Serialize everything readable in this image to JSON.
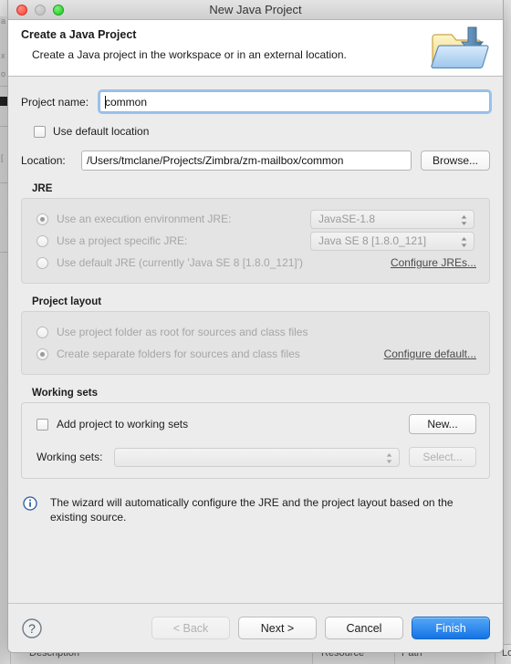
{
  "window": {
    "title": "New Java Project",
    "traffic_lights": [
      "close-red",
      "minimize-disabled",
      "zoom-green"
    ]
  },
  "header": {
    "title": "Create a Java Project",
    "subtitle": "Create a Java project in the workspace or in an external location.",
    "icon": "import-project-folder-icon"
  },
  "form": {
    "project_name_label": "Project name:",
    "project_name_value": "common",
    "use_default_location_label": "Use default location",
    "use_default_location_checked": false,
    "location_label": "Location:",
    "location_value": "/Users/tmclane/Projects/Zimbra/zm-mailbox/common",
    "browse_label": "Browse..."
  },
  "jre": {
    "group_title": "JRE",
    "options": [
      {
        "label": "Use an execution environment JRE:",
        "selected": true,
        "combo": "JavaSE-1.8"
      },
      {
        "label": "Use a project specific JRE:",
        "selected": false,
        "combo": "Java SE 8 [1.8.0_121]"
      },
      {
        "label": "Use default JRE (currently 'Java SE 8 [1.8.0_121]')",
        "selected": false,
        "combo": null
      }
    ],
    "configure_link": "Configure JREs..."
  },
  "layout": {
    "group_title": "Project layout",
    "options": [
      {
        "label": "Use project folder as root for sources and class files",
        "selected": false
      },
      {
        "label": "Create separate folders for sources and class files",
        "selected": true
      }
    ],
    "configure_link": "Configure default..."
  },
  "working_sets": {
    "group_title": "Working sets",
    "add_label": "Add project to working sets",
    "add_checked": false,
    "new_label": "New...",
    "sets_label": "Working sets:",
    "sets_value": "",
    "select_label": "Select..."
  },
  "info": {
    "icon": "info-circle-icon",
    "text": "The wizard will automatically configure the JRE and the project layout based on the existing source."
  },
  "footer": {
    "help_label": "help-question-icon",
    "back_label": "< Back",
    "back_enabled": false,
    "next_label": "Next >",
    "cancel_label": "Cancel",
    "finish_label": "Finish",
    "finish_color": "#1473e6"
  },
  "background": {
    "columns": [
      "Description",
      "Resource",
      "Path",
      "Loc"
    ],
    "edge_letters": [
      "a",
      "x",
      "o",
      "l",
      "["
    ]
  }
}
